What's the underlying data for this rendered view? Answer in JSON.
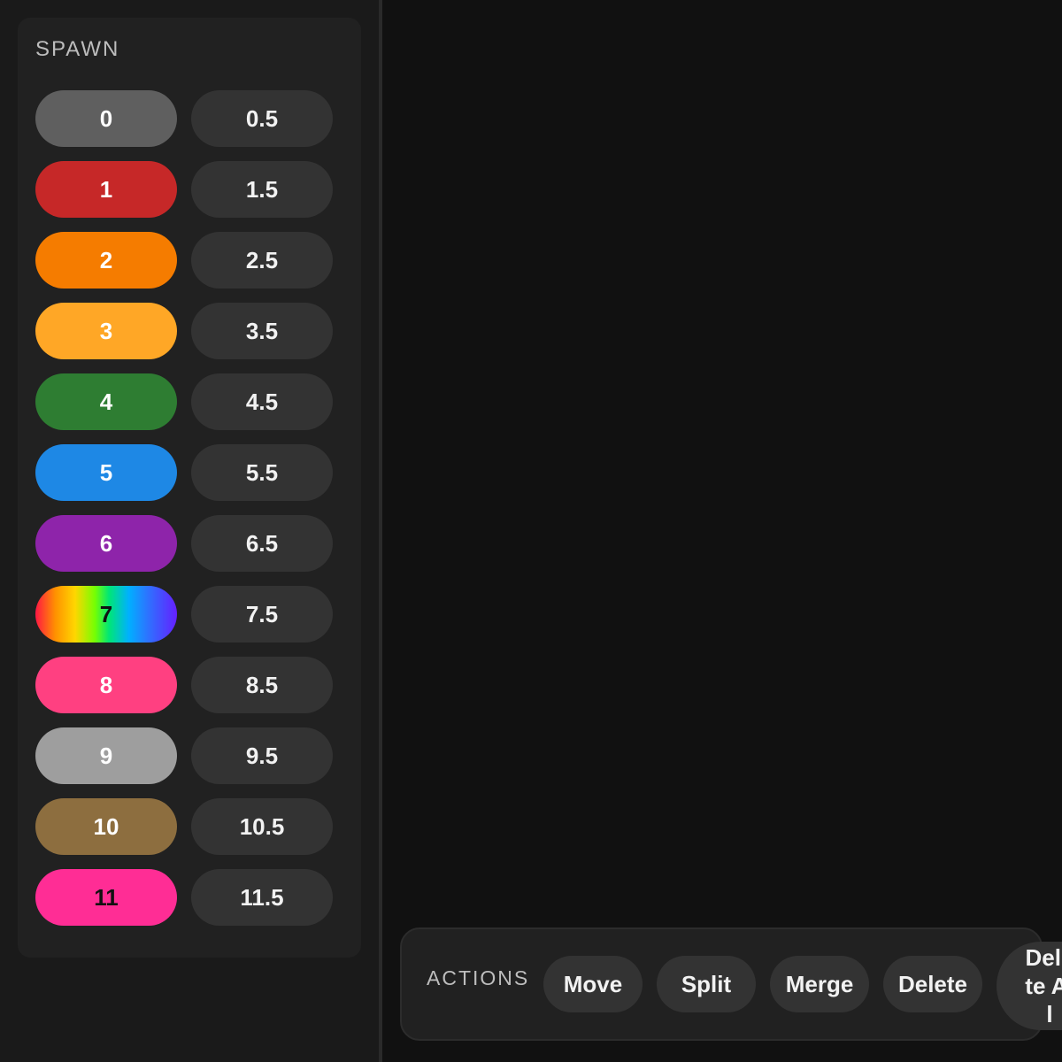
{
  "spawn": {
    "title": "SPAWN",
    "whole": [
      {
        "label": "0",
        "bg": "#5f5f5f",
        "fg": "#ffffff"
      },
      {
        "label": "1",
        "bg": "#c62828",
        "fg": "#ffffff"
      },
      {
        "label": "2",
        "bg": "#f57c00",
        "fg": "#ffffff"
      },
      {
        "label": "3",
        "bg": "#ffa726",
        "fg": "#ffffff"
      },
      {
        "label": "4",
        "bg": "#2e7d32",
        "fg": "#ffffff"
      },
      {
        "label": "5",
        "bg": "#1e88e5",
        "fg": "#ffffff"
      },
      {
        "label": "6",
        "bg": "#8e24aa",
        "fg": "#ffffff"
      },
      {
        "label": "7",
        "bg": "linear-gradient(90deg, #ff1744 0%, #ff9100 14%, #ffd600 28%, #76ff03 42%, #00e676 52%, #00b0ff 66%, #2979ff 78%, #651fff 100%)",
        "fg": "#111111"
      },
      {
        "label": "8",
        "bg": "#ff4081",
        "fg": "#ffffff"
      },
      {
        "label": "9",
        "bg": "#9e9e9e",
        "fg": "#ffffff"
      },
      {
        "label": "10",
        "bg": "#8d6e3f",
        "fg": "#ffffff"
      },
      {
        "label": "11",
        "bg": "#ff2d95",
        "fg": "#111111"
      }
    ],
    "half": [
      "0.5",
      "1.5",
      "2.5",
      "3.5",
      "4.5",
      "5.5",
      "6.5",
      "7.5",
      "8.5",
      "9.5",
      "10.5",
      "11.5"
    ]
  },
  "actions": {
    "title": "ACTIONS",
    "move": "Move",
    "split": "Split",
    "merge": "Merge",
    "delete": "Delete",
    "delete_all": "Delete All"
  }
}
